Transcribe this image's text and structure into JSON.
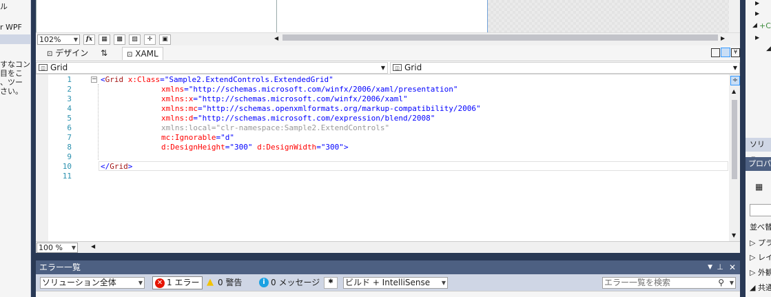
{
  "left_panel": {
    "line1": "ル",
    "line2": "r WPF",
    "line3": "すなコン",
    "line4": "目をこ",
    "line5": "、ツー",
    "line6": "さい。"
  },
  "zoom_toolbar": {
    "zoom": "102%",
    "fx": "fx"
  },
  "tabs": {
    "design": "デザイン",
    "swap": "⇅",
    "xaml": "XAML"
  },
  "navbar": {
    "left": "Grid",
    "right": "Grid"
  },
  "editor": {
    "line_numbers": [
      "1",
      "2",
      "3",
      "4",
      "5",
      "6",
      "7",
      "8",
      "9",
      "10",
      "11"
    ],
    "lines": {
      "l1_open": "<",
      "l1_tag": "Grid",
      "l1_attr": " x:Class",
      "l1_eq": "=",
      "l1_val": "\"Sample2.ExtendControls.ExtendedGrid\"",
      "l2_attr": "xmlns",
      "l2_val": "\"http://schemas.microsoft.com/winfx/2006/xaml/presentation\"",
      "l3_attr": "xmlns:x",
      "l3_val": "\"http://schemas.microsoft.com/winfx/2006/xaml\"",
      "l4_attr": "xmlns:mc",
      "l4_val": "\"http://schemas.openxmlformats.org/markup-compatibility/2006\"",
      "l5_attr": "xmlns:d",
      "l5_val": "\"http://schemas.microsoft.com/expression/blend/2008\"",
      "l6": "xmlns:local=\"clr-namespace:Sample2.ExtendControls\"",
      "l7_attr": "mc:Ignorable",
      "l7_val": "\"d\"",
      "l8_attr1": "d:DesignHeight",
      "l8_val1": "\"300\"",
      "l8_attr2": " d:DesignWidth",
      "l8_val2": "\"300\"",
      "l8_close": ">",
      "l10_open": "</",
      "l10_tag": "Grid",
      "l10_close": ">"
    },
    "zoom": "100 %"
  },
  "error_list": {
    "title": "エラー一覧",
    "scope": "ソリューション全体",
    "errors": "1 エラー",
    "warnings": "0 警告",
    "messages": "0 メッセージ",
    "build": "ビルド + IntelliSense",
    "search_placeholder": "エラー一覧を検索"
  },
  "right_panel": {
    "solution_label": "ソリュー",
    "properties_label": "プロパ",
    "sort_label": "並べ替",
    "item1": "プラ",
    "item2": "レイ",
    "item3": "外観",
    "item4": "共通"
  },
  "colors": {
    "accent": "#4d6082",
    "frame_bg": "#293955",
    "error_red": "#e51400",
    "warn_yellow": "#f2c200",
    "info_blue": "#1ba1e2"
  }
}
